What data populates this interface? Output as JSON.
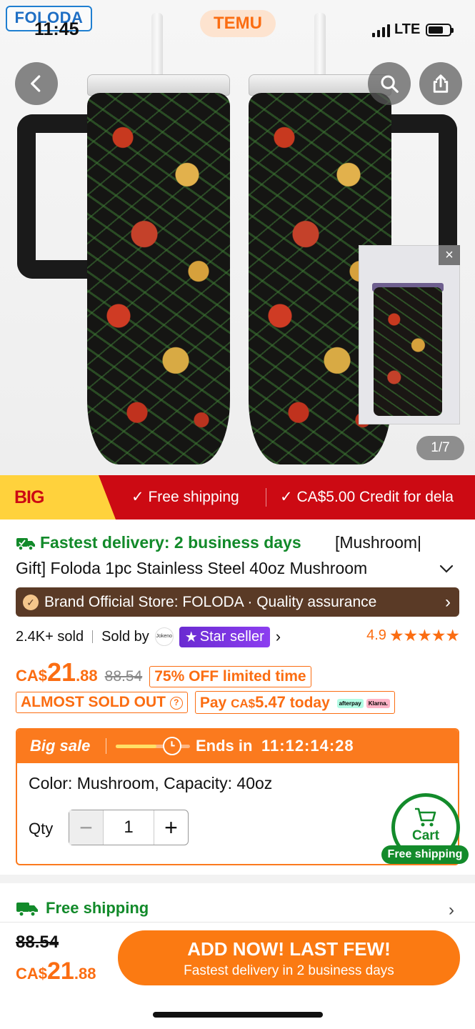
{
  "status_bar": {
    "time": "11:45",
    "network": "LTE"
  },
  "brand_logo": "FOLODA",
  "app_pill": "TEMU",
  "gallery": {
    "counter": "1/7",
    "close": "×"
  },
  "banner": {
    "promo": "BIG SAVINGS",
    "items": [
      "Free shipping",
      "CA$5.00 Credit for dela"
    ]
  },
  "product": {
    "delivery": "Fastest delivery: 2 business days",
    "title_line1": "[Mushroom|",
    "title_line2": "Gift] Foloda 1pc Stainless Steel 40oz Mushroom"
  },
  "store": {
    "text": "Brand Official Store: FOLODA · Quality assurance"
  },
  "sales": {
    "sold": "2.4K+ sold",
    "sold_by": "Sold by",
    "seller_logo_text": "Jokeno",
    "star_seller": "Star seller",
    "rating": "4.9",
    "stars": "★★★★★"
  },
  "price": {
    "currency": "CA$",
    "whole": "21",
    "decimal": ".88",
    "old": "88.54",
    "discount": "75% OFF limited time"
  },
  "tags": {
    "almost_sold": "ALMOST SOLD OUT",
    "pay_prefix": "Pay",
    "pay_currency": "CA$",
    "pay_amount": "5.47",
    "pay_suffix": "today",
    "afterpay": "afterpay",
    "klarna": "Klarna."
  },
  "sale": {
    "label": "Big sale",
    "ends_label": "Ends in",
    "countdown": "11:12:14:28",
    "progress": 0.55,
    "color_line": "Color: Mushroom, Capacity: 40oz",
    "qty_label": "Qty",
    "qty_value": "1",
    "minus": "−",
    "plus": "+"
  },
  "cart": {
    "label": "Cart",
    "free_shipping": "Free shipping"
  },
  "shipping_row": {
    "text": "Free shipping"
  },
  "bottom": {
    "old_price": "88.54",
    "currency": "CA$",
    "whole": "21",
    "decimal": ".88",
    "cta_main": "ADD NOW! LAST FEW!",
    "cta_sub": "Fastest delivery in 2 business days"
  },
  "colors": {
    "accent": "#fb6d12",
    "green": "#128a2a",
    "banner_red": "#cc0a13",
    "store_brown": "#5a3a26",
    "star_purple": "#7a34e0"
  }
}
